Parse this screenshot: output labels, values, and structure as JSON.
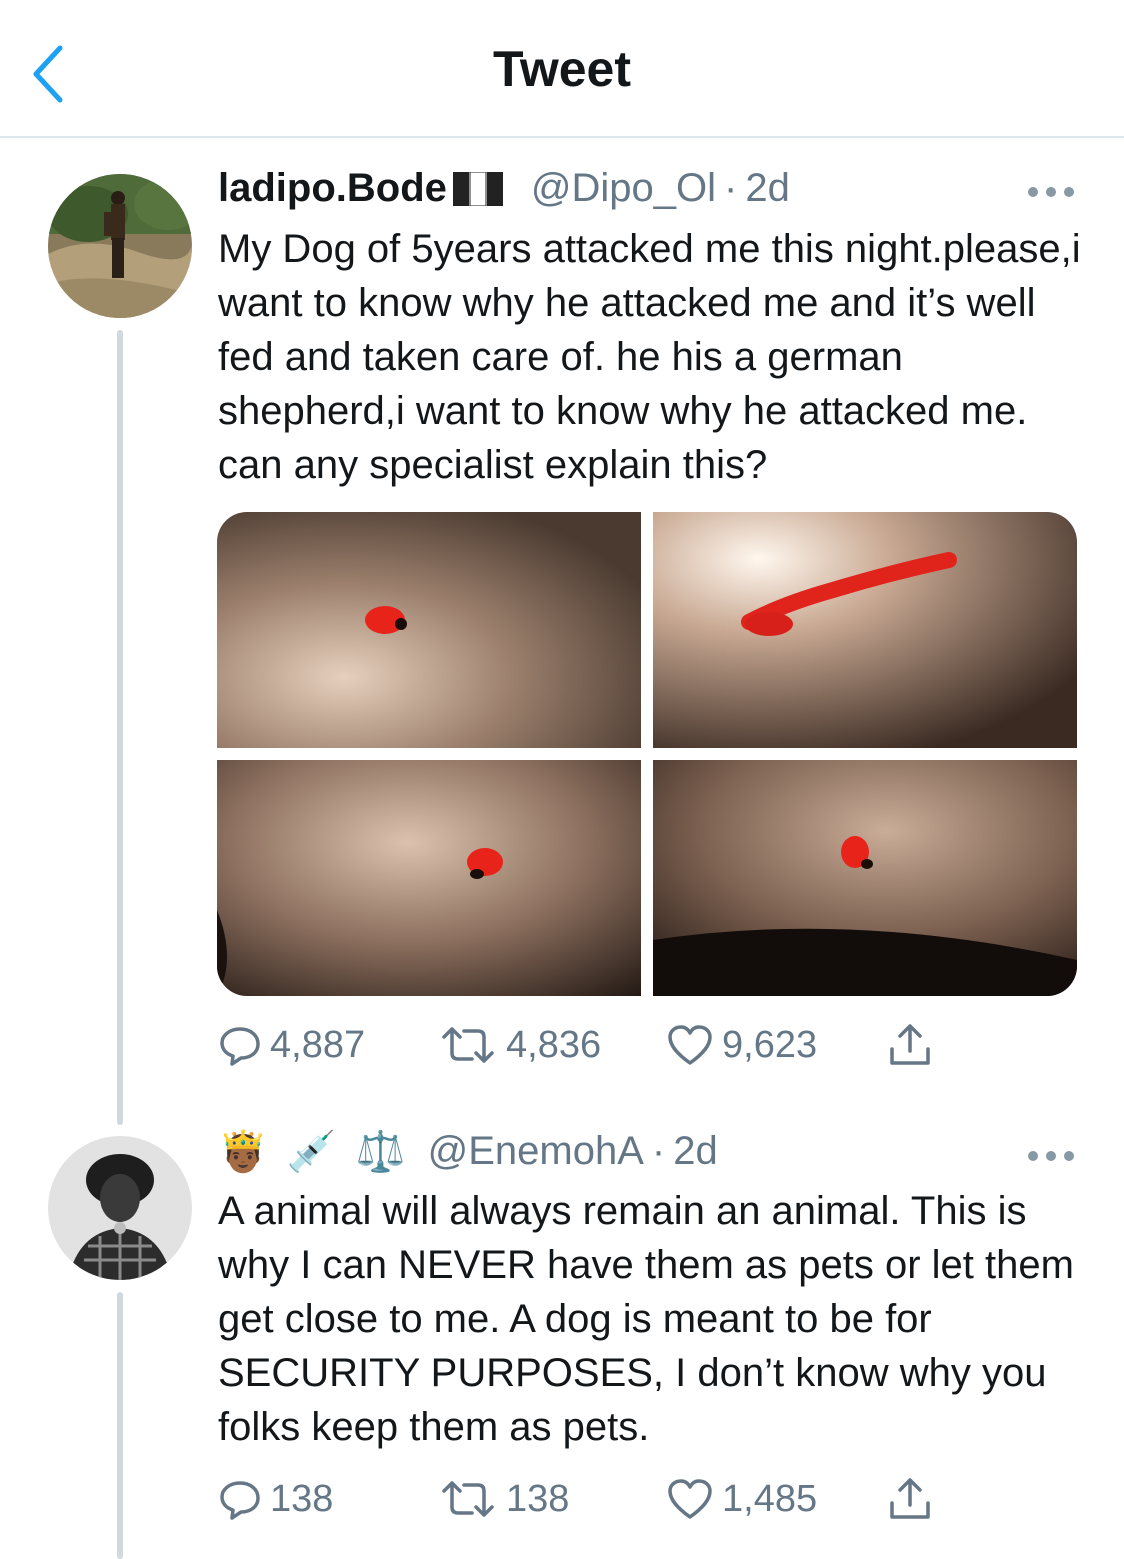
{
  "header": {
    "title": "Tweet",
    "back_icon": "chevron-left-icon"
  },
  "colors": {
    "accent": "#1da1f2",
    "secondary_text": "#657786",
    "divider": "#e1e8ed"
  },
  "tweets": [
    {
      "display_name": "ladipo.Bode",
      "name_emoji": "🇳🇬",
      "handle": "@Dipo_Ol",
      "separator": "·",
      "time": "2d",
      "text": "My Dog of 5years attacked me this night.please,i want to know why he attacked me and it’s well fed and taken care of. he his a german shepherd,i want to know why he attacked me. can any specialist explain this?",
      "media_count": 4,
      "replies": "4,887",
      "retweets": "4,836",
      "likes": "9,623"
    },
    {
      "display_name": "🤴🏾 💉 ⚖️",
      "handle": "@EnemohA",
      "separator": "·",
      "time": "2d",
      "text": "A animal will always remain an animal. This is why I can NEVER have them as pets or let them get close to me. A dog is meant to be for SECURITY PURPOSES, I don’t know why you folks keep them as pets.",
      "replies": "138",
      "retweets": "138",
      "likes": "1,485"
    }
  ]
}
